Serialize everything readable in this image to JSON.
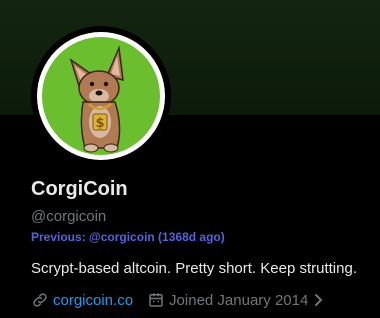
{
  "profile": {
    "name": "CorgiCoin",
    "handle": "@corgicoin",
    "previous": "Previous: @corgicoin (1368d ago)",
    "bio": "Scrypt-based altcoin. Pretty short. Keep strutting.",
    "website": "corgicoin.co",
    "joined": "Joined January 2014"
  },
  "icons": {
    "link": "link-icon",
    "calendar": "calendar-icon",
    "chevron": "chevron-right-icon"
  },
  "colors": {
    "banner": "#132510",
    "avatar_bg": "#6bbf2f",
    "link": "#1d9bf0",
    "previous": "#5464d9",
    "muted": "#71767b"
  }
}
